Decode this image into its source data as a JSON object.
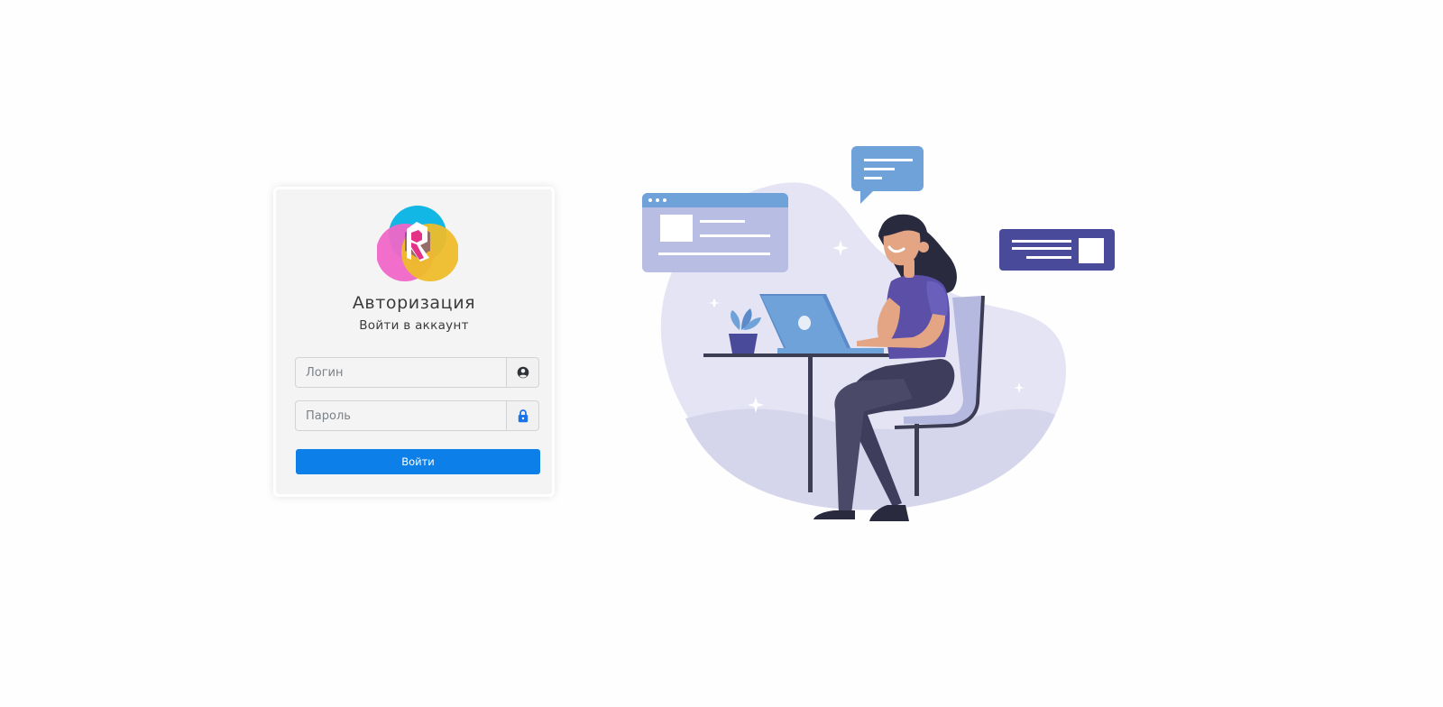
{
  "auth": {
    "title": "Авторизация",
    "subtitle": "Войти в аккаунт",
    "login_placeholder": "Логин",
    "password_placeholder": "Пароль",
    "submit_label": "Войти"
  },
  "icons": {
    "logo": "brand-logo",
    "login_addon": "user-circle-icon",
    "password_addon": "lock-icon"
  },
  "colors": {
    "primary": "#0d7fe8",
    "card_background": "#f4f4f4",
    "text": "#3b3b3b",
    "illustration_blob": "#dcdcf0",
    "illustration_accent": "#4a4a9a"
  }
}
